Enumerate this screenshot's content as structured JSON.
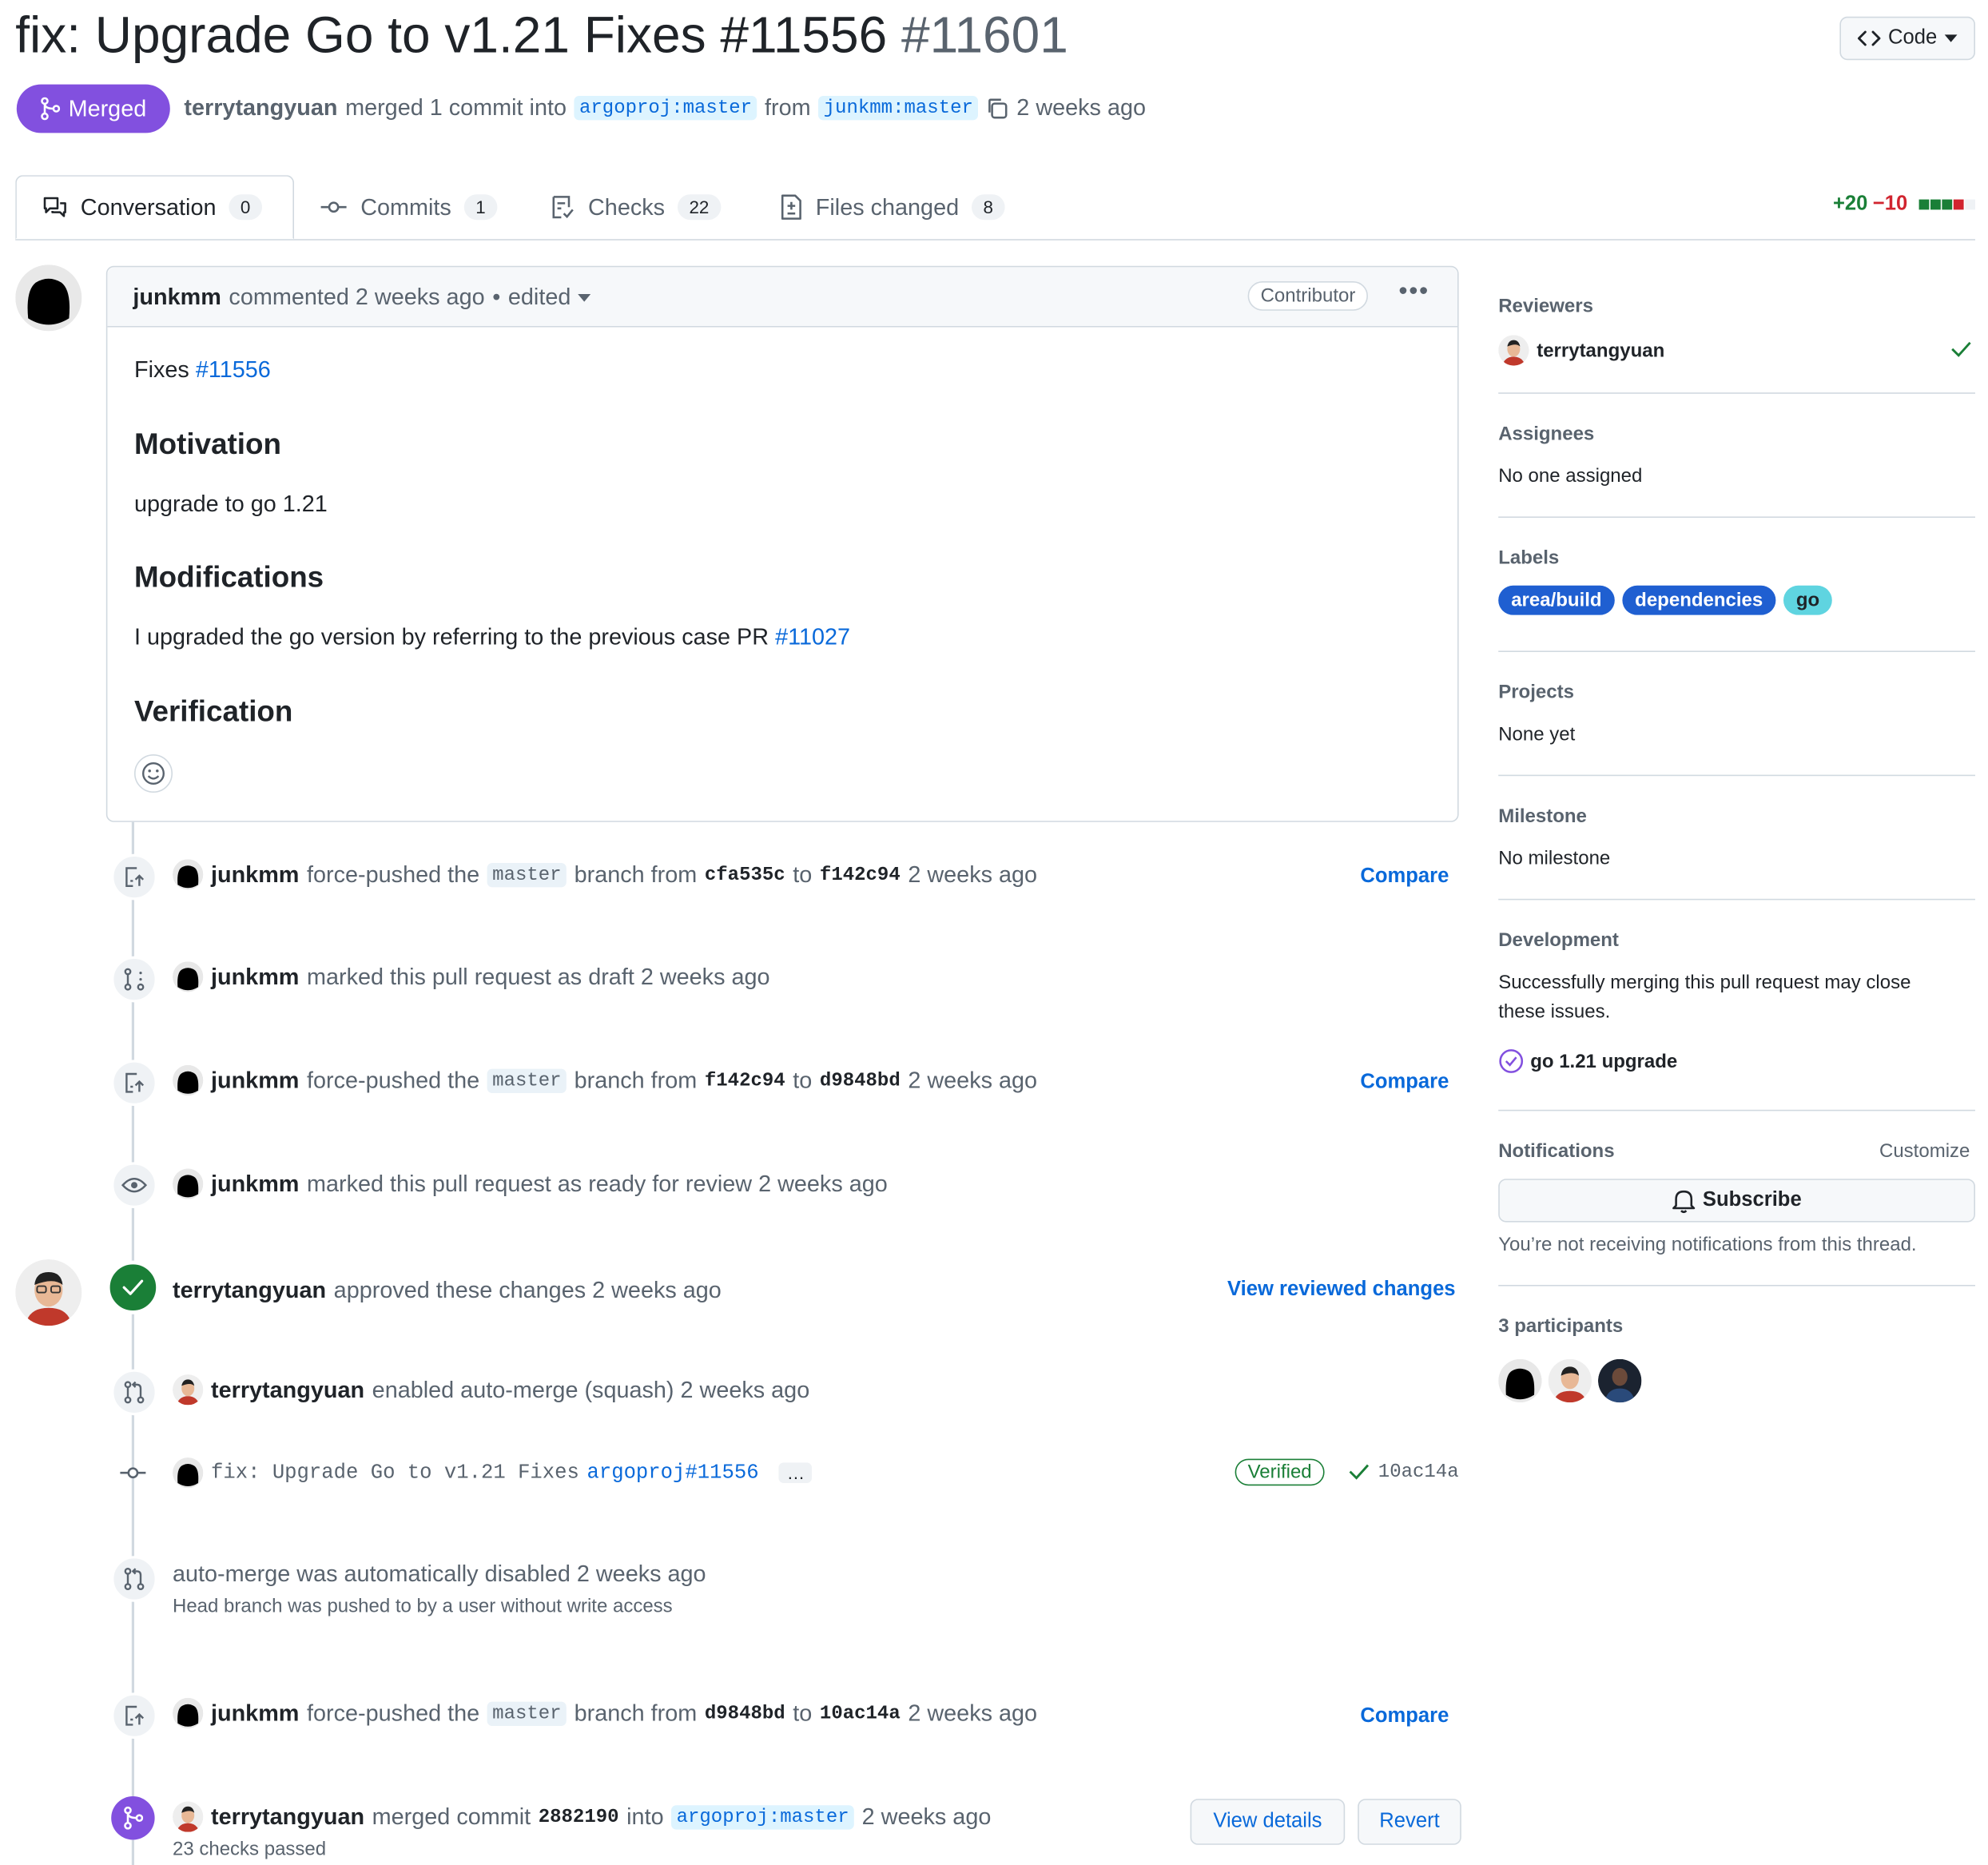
{
  "pr": {
    "title": "fix: Upgrade Go to v1.21 Fixes #11556",
    "number": "#11601",
    "code_button": "Code",
    "state": "Merged",
    "merger": "terrytangyuan",
    "merged_text": "merged 1 commit into",
    "base_branch": "argoproj:master",
    "from_text": "from",
    "head_branch": "junkmm:master",
    "time": "2 weeks ago"
  },
  "tabs": [
    {
      "label": "Conversation",
      "count": "0"
    },
    {
      "label": "Commits",
      "count": "1"
    },
    {
      "label": "Checks",
      "count": "22"
    },
    {
      "label": "Files changed",
      "count": "8"
    }
  ],
  "diffstat": {
    "additions": "+20",
    "deletions": "−10"
  },
  "comment": {
    "author": "junkmm",
    "action": "commented 2 weeks ago",
    "separator": "•",
    "edited": "edited",
    "badge": "Contributor",
    "fixes_text": "Fixes",
    "fixes_link": "#11556",
    "h_motivation": "Motivation",
    "motivation": "upgrade to go 1.21",
    "h_modifications": "Modifications",
    "modifications_text": "I upgraded the go version by referring to the previous case PR",
    "modifications_link": "#11027",
    "h_verification": "Verification"
  },
  "timeline": {
    "e1": {
      "user": "junkmm",
      "t1": "force-pushed the",
      "branch": "master",
      "t2": "branch from",
      "from": "cfa535c",
      "to_word": "to",
      "to": "f142c94",
      "time": "2 weeks ago",
      "link": "Compare"
    },
    "e2": {
      "user": "junkmm",
      "text": "marked this pull request as draft 2 weeks ago"
    },
    "e3": {
      "user": "junkmm",
      "t1": "force-pushed the",
      "branch": "master",
      "t2": "branch from",
      "from": "f142c94",
      "to_word": "to",
      "to": "d9848bd",
      "time": "2 weeks ago",
      "link": "Compare"
    },
    "e4": {
      "user": "junkmm",
      "text": "marked this pull request as ready for review 2 weeks ago"
    },
    "e5": {
      "user": "terrytangyuan",
      "text": "approved these changes 2 weeks ago",
      "link": "View reviewed changes"
    },
    "e6": {
      "user": "terrytangyuan",
      "text": "enabled auto-merge (squash) 2 weeks ago"
    },
    "e7": {
      "message": "fix: Upgrade Go to v1.21 Fixes",
      "ref": "argoproj#11556",
      "ellipsis": "…",
      "verified": "Verified",
      "sha": "10ac14a"
    },
    "e8": {
      "text": "auto-merge was automatically disabled 2 weeks ago",
      "sub": "Head branch was pushed to by a user without write access"
    },
    "e9": {
      "user": "junkmm",
      "t1": "force-pushed the",
      "branch": "master",
      "t2": "branch from",
      "from": "d9848bd",
      "to_word": "to",
      "to": "10ac14a",
      "time": "2 weeks ago",
      "link": "Compare"
    },
    "e10": {
      "user": "terrytangyuan",
      "t1": "merged commit",
      "commit": "2882190",
      "t2": "into",
      "branch": "argoproj:master",
      "time": "2 weeks ago",
      "sub": "23 checks passed",
      "btn1": "View details",
      "btn2": "Revert"
    }
  },
  "sidebar": {
    "reviewers_label": "Reviewers",
    "reviewer": "terrytangyuan",
    "assignees_label": "Assignees",
    "assignees": "No one assigned",
    "labels_label": "Labels",
    "labels": [
      "area/build",
      "dependencies",
      "go"
    ],
    "projects_label": "Projects",
    "projects": "None yet",
    "milestone_label": "Milestone",
    "milestone": "No milestone",
    "development_label": "Development",
    "development_line1": "Successfully merging this pull request may close",
    "development_line2": "these issues.",
    "issue": "go 1.21 upgrade",
    "notifications_label": "Notifications",
    "customize": "Customize",
    "subscribe": "Subscribe",
    "notif_note": "You’re not receiving notifications from this thread.",
    "participants": "3 participants"
  },
  "colors": {
    "merged": "#8250df",
    "link": "#0969da",
    "success": "#1a7f37",
    "danger": "#d1242f",
    "label_area": "#1f5fd1",
    "label_deps": "#1f5fd1",
    "label_go": "#5fd4e0"
  }
}
